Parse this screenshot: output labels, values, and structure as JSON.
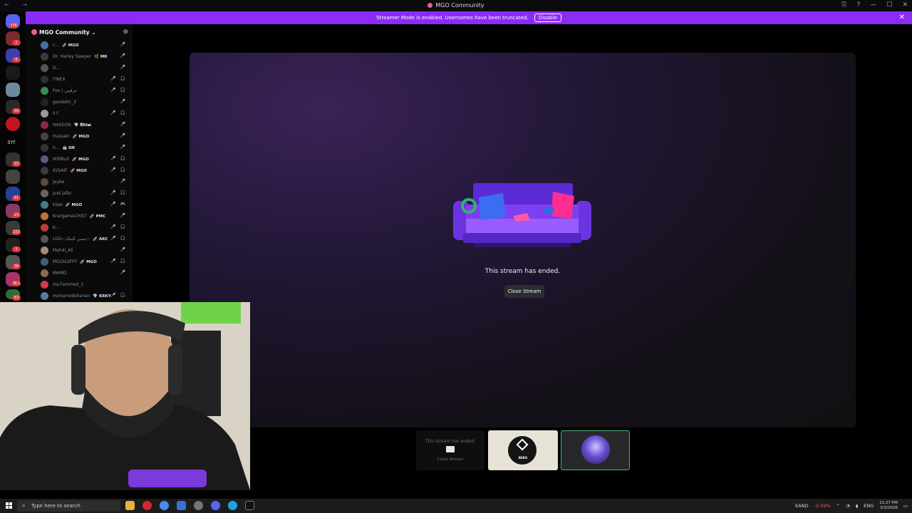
{
  "window": {
    "title": "MGO Community",
    "controls": [
      "⎘",
      "?",
      "—",
      "☐",
      "✕"
    ]
  },
  "banner": {
    "text": "Streamer Mode is enabled. Usernames have been truncated.",
    "button": "Disable",
    "close": "✕"
  },
  "rail": {
    "badges": [
      "338",
      "1",
      "6",
      "16",
      "22",
      "61",
      "23",
      "153",
      "1",
      "30",
      "3K+",
      "63"
    ],
    "label_3yf": "3Yf"
  },
  "server": {
    "name": "MGO Community",
    "chevron": "⌄",
    "add_friend_icon": "person-plus-icon"
  },
  "members": [
    {
      "name": "c...",
      "tag": "🚀 MGO",
      "status": "🎤"
    },
    {
      "name": "Dr. Harley Sawyer",
      "tag": "🌿 MR",
      "status": "🎤"
    },
    {
      "name": "D...",
      "tag": "",
      "status": "🎤"
    },
    {
      "name": "FINEX",
      "tag": "",
      "status": "🎤 🎧"
    },
    {
      "name": "Fox | عرقيتي",
      "tag": "",
      "status": "🎤 🎧"
    },
    {
      "name": "geodetic_3",
      "tag": "",
      "status": "🎤"
    },
    {
      "name": "ll f",
      "tag": "",
      "status": "🎤 🎧"
    },
    {
      "name": "HASSON",
      "tag": "💎 𝕬𝕷𝕿𝖚𝖝",
      "status": "🎤"
    },
    {
      "name": "Hussain",
      "tag": "🚀 MGO",
      "status": "🎤"
    },
    {
      "name": "h...",
      "tag": "🤖 DR",
      "status": "🎤"
    },
    {
      "name": "IKIRBuS",
      "tag": "🚀 MGO",
      "status": "🎤 🎧"
    },
    {
      "name": "ItzSAIF",
      "tag": "🚀 MGO",
      "status": "🎤 🎧"
    },
    {
      "name": "Jaybe",
      "tag": "",
      "status": "🎤"
    },
    {
      "name": "Just jafar",
      "tag": "",
      "status": "🎤 🎧"
    },
    {
      "name": "klaw",
      "tag": "🚀 MGO",
      "status": "🎤 🎮"
    },
    {
      "name": "Krargames7657",
      "tag": "🚀 PMC",
      "status": "🎤"
    },
    {
      "name": "K...",
      "tag": "",
      "status": "🎤 🎧"
    },
    {
      "name": "LGG~سمي الملك~",
      "tag": "🚀 ARC",
      "status": "🎤 🎧"
    },
    {
      "name": "Mahdi_Ali",
      "tag": "",
      "status": "🎤"
    },
    {
      "name": "MGOILUFFY",
      "tag": "🚀 MGO",
      "status": "🎤 🎧"
    },
    {
      "name": "MHMD",
      "tag": "",
      "status": "🎤"
    },
    {
      "name": "mo7ammed_1",
      "tag": "",
      "status": ""
    },
    {
      "name": "mohamedshanan",
      "tag": "💎 KRKY",
      "status": "🎤 🎧"
    }
  ],
  "stream": {
    "ended_text": "This stream has ended.",
    "close_button": "Close Stream"
  },
  "tiles": {
    "tile1_text": "This stream has ended.",
    "tile1_button": "Close Stream",
    "tile2_logo": "BERO"
  },
  "taskbar": {
    "search_placeholder": "Type here to search",
    "ticker": "EAND",
    "ticker_change": "-2.59%",
    "lang": "ENG",
    "time": "11:27 PM",
    "date": "3/3/2026"
  }
}
